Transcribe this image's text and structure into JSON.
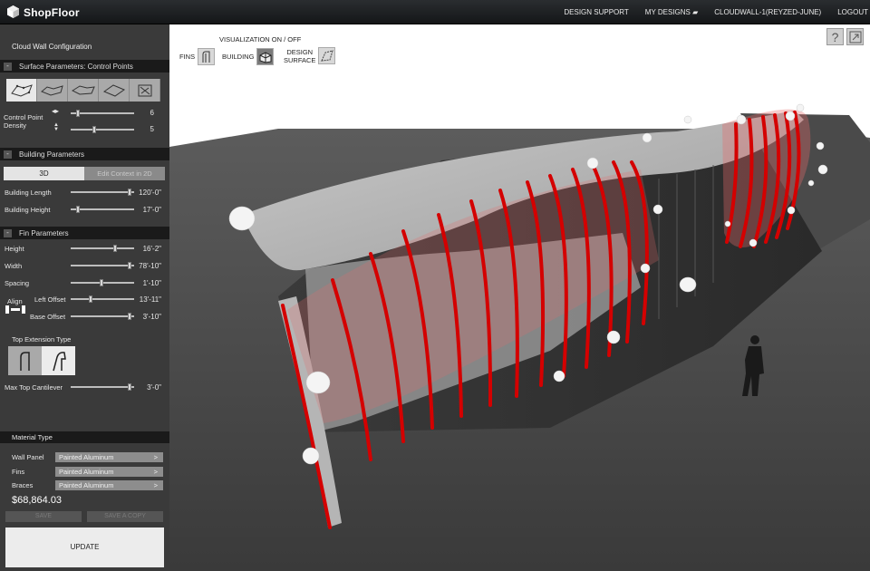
{
  "app": {
    "name": "ShopFloor"
  },
  "nav": {
    "design_support": "DESIGN SUPPORT",
    "my_designs": "MY DESIGNS",
    "project": "CLOUDWALL-1(REYZED-JUNE)",
    "logout": "LOGOUT"
  },
  "config_title": "Cloud Wall Configuration",
  "surface": {
    "header": "Surface Parameters: Control Points",
    "density_label": "Control Point Density",
    "density_horizontal": "6",
    "density_vertical": "5"
  },
  "building": {
    "header": "Building Parameters",
    "tab_3d": "3D",
    "tab_2d": "Edit Context in 2D",
    "length_label": "Building Length",
    "length_value": "120'-0\"",
    "height_label": "Building Height",
    "height_value": "17'-0\""
  },
  "fin": {
    "header": "Fin Parameters",
    "height_label": "Height",
    "height_value": "16'-2\"",
    "width_label": "Width",
    "width_value": "78'-10\"",
    "spacing_label": "Spacing",
    "spacing_value": "1'-10\"",
    "align_label": "Align",
    "left_offset_label": "Left Offset",
    "left_offset_value": "13'-11\"",
    "base_offset_label": "Base Offset",
    "base_offset_value": "3'-10\"",
    "top_ext_label": "Top Extension Type",
    "cantilever_label": "Max Top Cantilever",
    "cantilever_value": "3'-0\""
  },
  "material": {
    "header": "Material Type",
    "rows": [
      {
        "label": "Wall Panel",
        "value": "Painted Aluminum"
      },
      {
        "label": "Fins",
        "value": "Painted Aluminum"
      },
      {
        "label": "Braces",
        "value": "Painted Aluminum"
      }
    ],
    "arrow": ">"
  },
  "price": "$68,864.03",
  "buttons": {
    "save": "SAVE",
    "save_copy": "SAVE A COPY",
    "update": "UPDATE"
  },
  "visualization": {
    "title": "VISUALIZATION ON / OFF",
    "fins": "FINS",
    "building": "BUILDING",
    "design_surface_1": "DESIGN",
    "design_surface_2": "SURFACE"
  },
  "help": "?",
  "colors": {
    "fin_red": "#d40000",
    "panel_bg": "#3a3a3a",
    "section_bar": "#1a1a1a"
  },
  "icons": [
    "shopfloor-logo-icon",
    "folder-icon",
    "help-icon",
    "popout-icon",
    "fins-icon",
    "building-icon",
    "design-surface-icon",
    "arrow-left-right-icon",
    "arrow-up-down-icon"
  ]
}
